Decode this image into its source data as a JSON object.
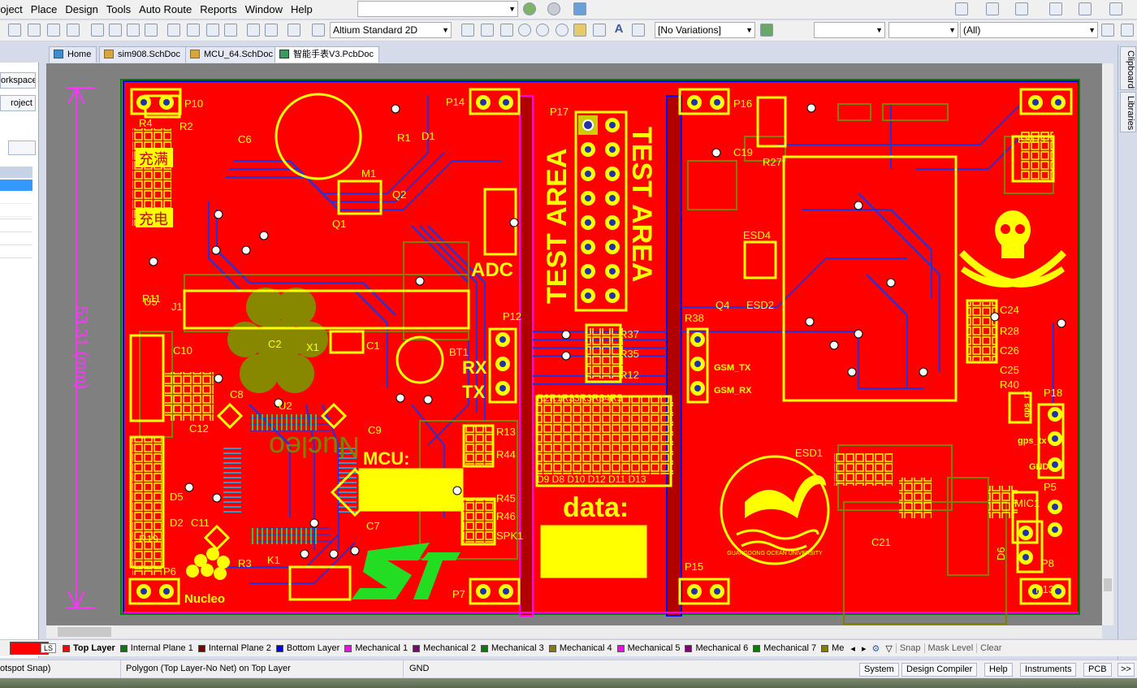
{
  "menu": [
    "roject",
    "Place",
    "Design",
    "Tools",
    "Auto Route",
    "Reports",
    "Window",
    "Help"
  ],
  "toolbar": {
    "view_config": "Altium Standard 2D",
    "variations": "[No Variations]",
    "filter": "(All)"
  },
  "tabs": [
    {
      "label": "Home",
      "icon": "home-icon"
    },
    {
      "label": "sim908.SchDoc",
      "icon": "schematic-icon"
    },
    {
      "label": "MCU_64.SchDoc",
      "icon": "schematic-icon"
    },
    {
      "label": "智能手表V3.PcbDoc",
      "icon": "pcb-icon"
    }
  ],
  "left_panel": {
    "workspace": "orkspace",
    "project": "roject",
    "messages": "ssages"
  },
  "right_panel": [
    "Clipboard",
    "Libraries"
  ],
  "pcb": {
    "dimension": "53.31 (mm)",
    "test_area": "TEST AREA",
    "adc": "ADC",
    "rx": "RX",
    "tx": "TX",
    "mcu": "MCU:",
    "data": "data:",
    "nucleo": "Nucleo",
    "gsm_tx": "GSM_TX",
    "gsm_rx": "GSM_RX",
    "gps_tx": "gps_tx",
    "gps_rx": "gps_rx",
    "gnd": "GND",
    "chinese_labels": [
      "充满",
      "充电"
    ],
    "university": "GUANGDONG OCEAN UNIVERSITY",
    "designators": [
      "P10",
      "P14",
      "P16",
      "P17",
      "P12",
      "P18",
      "P5",
      "P8",
      "P13",
      "P15",
      "P7",
      "P6",
      "R4",
      "R2",
      "R1",
      "D1",
      "Q2",
      "Q1",
      "M1",
      "U3",
      "U5",
      "U6",
      "R11",
      "J1",
      "X1",
      "C2",
      "C1",
      "BT1",
      "C10",
      "C12",
      "C8",
      "U2",
      "C9",
      "C7",
      "K1",
      "R3",
      "R19",
      "D5",
      "D2",
      "C11",
      "C6",
      "C5",
      "R5",
      "R7",
      "R8",
      "P11",
      "R38",
      "Q4",
      "ESD2",
      "ESD4",
      "ESD3",
      "ESD1",
      "C21",
      "C19",
      "R27",
      "C24",
      "R28",
      "C26",
      "C25",
      "R40",
      "R37",
      "R35",
      "R12",
      "R13",
      "R44",
      "R45",
      "R46",
      "SPK1",
      "MIC1",
      "D6",
      "D8",
      "D10",
      "D12",
      "D11",
      "D13",
      "R2",
      "R1",
      "R3",
      "R4",
      "R5"
    ],
    "data_leds": "D9 D8 D10 D12 D11 D13",
    "res_row": "R2R1R33R3R34R5"
  },
  "layers": [
    {
      "name": "Top Layer",
      "color": "#ff0000"
    },
    {
      "name": "Internal Plane 1",
      "color": "#008000"
    },
    {
      "name": "Internal Plane 2",
      "color": "#800000"
    },
    {
      "name": "Bottom Layer",
      "color": "#0000ff"
    },
    {
      "name": "Mechanical 1",
      "color": "#ff00ff"
    },
    {
      "name": "Mechanical 2",
      "color": "#800080"
    },
    {
      "name": "Mechanical 3",
      "color": "#008000"
    },
    {
      "name": "Mechanical 4",
      "color": "#808000"
    },
    {
      "name": "Mechanical 5",
      "color": "#ff00ff"
    },
    {
      "name": "Mechanical 6",
      "color": "#800080"
    },
    {
      "name": "Mechanical 7",
      "color": "#008000"
    },
    {
      "name": "Me",
      "color": "#808000"
    }
  ],
  "layer_tools": {
    "ls": "LS",
    "snap": "Snap",
    "mask": "Mask Level",
    "clear": "Clear"
  },
  "status": {
    "left": "otspot Snap)",
    "object": "Polygon  (Top Layer-No Net)  on Top Layer",
    "net": "GND",
    "buttons": [
      "System",
      "Design Compiler",
      "Help",
      "Instruments",
      "PCB",
      ">>"
    ]
  }
}
